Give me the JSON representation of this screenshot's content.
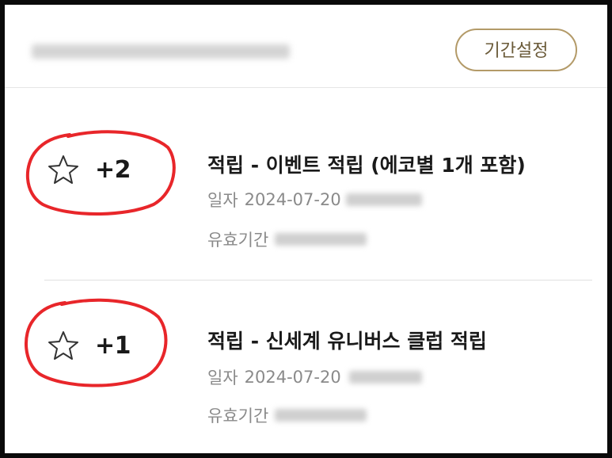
{
  "header": {
    "period_button_label": "기간설정"
  },
  "items": [
    {
      "points": "+2",
      "title": "적립 - 이벤트 적립 (에코별 1개 포함)",
      "date_label": "일자",
      "date_value": "2024-07-20",
      "expiry_label": "유효기간"
    },
    {
      "points": "+1",
      "title": "적립 - 신세계 유니버스 클럽 적립",
      "date_label": "일자",
      "date_value": "2024-07-20",
      "expiry_label": "유효기간"
    }
  ],
  "colors": {
    "accent_border": "#b39a68",
    "annotation_red": "#e8262a",
    "text_dark": "#1a1a1a",
    "text_muted": "#8a8a8a"
  },
  "icons": [
    "star-outline-icon"
  ]
}
